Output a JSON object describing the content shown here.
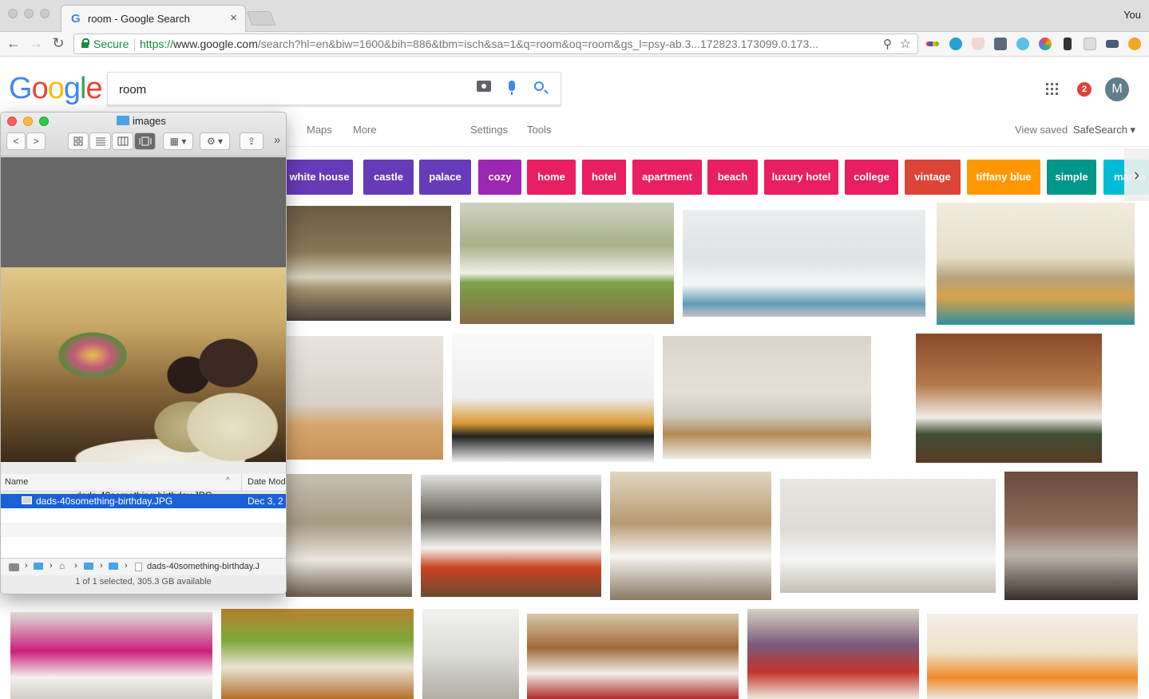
{
  "browser": {
    "tab_title": "room - Google Search",
    "tab_close": "×",
    "tab_favicon": "G",
    "user_label": "You",
    "secure_label": "Secure",
    "url_scheme": "https://",
    "url_host": "www.google.com",
    "url_rest": "/search?hl=en&biw=1600&bih=886&tbm=isch&sa=1&q=room&oq=room&gs_l=psy-ab.3...172823.173099.0.173...",
    "back_icon": "←",
    "forward_icon": "→",
    "reload_icon": "↻",
    "zoom_icon": "⚲",
    "star_icon": "☆",
    "extensions": [
      "ebay-icon",
      "circle-icon",
      "shield-icon",
      "grid-icon",
      "bird-icon",
      "pinwheel-icon",
      "pin-icon",
      "doc-icon",
      "bar-icon",
      "alert-icon"
    ]
  },
  "google": {
    "logo": [
      "G",
      "o",
      "o",
      "g",
      "l",
      "e"
    ],
    "logo_colors": [
      "#4285f4",
      "#ea4335",
      "#fbbc05",
      "#4285f4",
      "#34a853",
      "#ea4335"
    ],
    "query": "room",
    "menu": {
      "maps": "Maps",
      "more": "More",
      "settings": "Settings",
      "tools": "Tools",
      "view_saved": "View saved",
      "safesearch": "SafeSearch ▾"
    },
    "notifications": "2",
    "avatar_letter": "M",
    "chips": [
      {
        "label": "white house",
        "color": "#673ab7"
      },
      {
        "label": "castle",
        "color": "#673ab7"
      },
      {
        "label": "palace",
        "color": "#673ab7"
      },
      {
        "label": "cozy",
        "color": "#9c27b0"
      },
      {
        "label": "home",
        "color": "#e91e63"
      },
      {
        "label": "hotel",
        "color": "#e91e63"
      },
      {
        "label": "apartment",
        "color": "#e91e63"
      },
      {
        "label": "beach",
        "color": "#e91e63"
      },
      {
        "label": "luxury hotel",
        "color": "#e91e63"
      },
      {
        "label": "college",
        "color": "#e91e63"
      },
      {
        "label": "vintage",
        "color": "#db4437"
      },
      {
        "label": "tiffany blue",
        "color": "#ff9800"
      },
      {
        "label": "simple",
        "color": "#009688"
      },
      {
        "label": "martin",
        "color": "#00bcd4"
      }
    ],
    "chip_next": "›"
  },
  "finder": {
    "title": "images",
    "nav_back": "<",
    "nav_forward": ">",
    "view_icons": [
      "icon-view-icon",
      "list-view-icon",
      "column-view-icon",
      "cover-flow-icon"
    ],
    "group_label": "▦ ▾",
    "action_label": "⚙ ▾",
    "share_label": "⇪",
    "more_label": "»",
    "preview_caption": "dads-40something-birthday.JPG",
    "col_name": "Name",
    "col_date": "Date Mod",
    "sort_arrow": "^",
    "file_name": "dads-40something-birthday.JPG",
    "file_date": "Dec 3, 2",
    "path_end": "dads-40something-birthday.J",
    "status": "1 of 1 selected, 305.3 GB available"
  }
}
